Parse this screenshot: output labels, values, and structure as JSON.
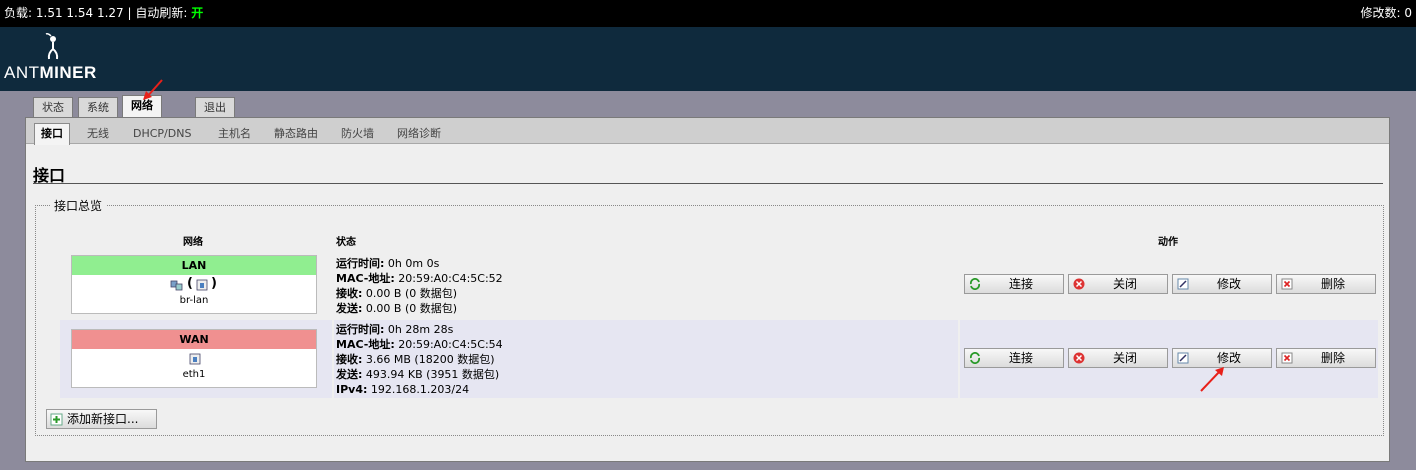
{
  "topbar": {
    "load_label": "负载:",
    "load_values": "1.51 1.54 1.27",
    "separator": "|",
    "auto_refresh_label": "自动刷新:",
    "auto_refresh_value": "开",
    "changes_label": "修改数: 0"
  },
  "header": {
    "brand_light": "ANT",
    "brand_bold": "MINER"
  },
  "main_tabs": [
    {
      "label": "状态"
    },
    {
      "label": "系统"
    },
    {
      "label": "网络"
    },
    {
      "label": "退出"
    }
  ],
  "sub_tabs": [
    {
      "label": "接口"
    },
    {
      "label": "无线"
    },
    {
      "label": "DHCP/DNS"
    },
    {
      "label": "主机名"
    },
    {
      "label": "静态路由"
    },
    {
      "label": "防火墙"
    },
    {
      "label": "网络诊断"
    }
  ],
  "page_title": "接口",
  "section_title": "接口总览",
  "table": {
    "col_network": "网络",
    "col_status": "状态",
    "col_actions": "动作"
  },
  "interfaces": [
    {
      "name": "LAN",
      "header_color": "#90ee90",
      "device_line": "(  )",
      "device": "br-lan",
      "status": [
        {
          "label": "运行时间:",
          "value": "0h 0m 0s"
        },
        {
          "label": "MAC-地址:",
          "value": "20:59:A0:C4:5C:52"
        },
        {
          "label": "接收:",
          "value": "0.00 B (0 数据包)"
        },
        {
          "label": "发送:",
          "value": "0.00 B (0 数据包)"
        }
      ]
    },
    {
      "name": "WAN",
      "header_color": "#f09090",
      "device": "eth1",
      "status": [
        {
          "label": "运行时间:",
          "value": "0h 28m 28s"
        },
        {
          "label": "MAC-地址:",
          "value": "20:59:A0:C4:5C:54"
        },
        {
          "label": "接收:",
          "value": "3.66 MB (18200 数据包)"
        },
        {
          "label": "发送:",
          "value": "493.94 KB (3951 数据包)"
        },
        {
          "label": "IPv4:",
          "value": "192.168.1.203/24"
        }
      ]
    }
  ],
  "actions": {
    "connect": "连接",
    "close": "关闭",
    "edit": "修改",
    "delete": "删除"
  },
  "add_interface": "添加新接口..."
}
